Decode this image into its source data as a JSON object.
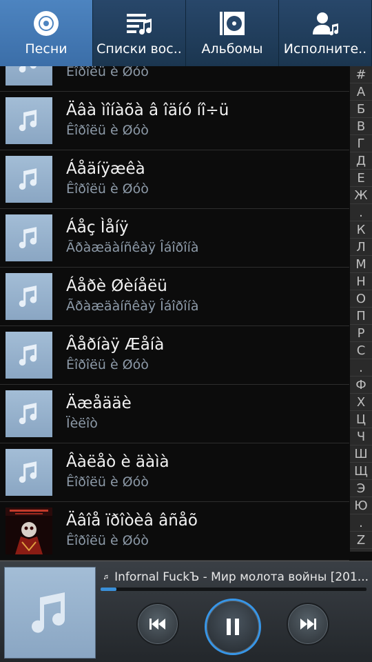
{
  "tabs": [
    {
      "label": "Песни",
      "icon": "disc-icon",
      "active": true
    },
    {
      "label": "Списки вос..",
      "icon": "playlist-icon",
      "active": false
    },
    {
      "label": "Альбомы",
      "icon": "album-icon",
      "active": false
    },
    {
      "label": "Исполните..",
      "icon": "artist-icon",
      "active": false
    }
  ],
  "songs": [
    {
      "title": "",
      "artist": "Êîðîëü è Øóò",
      "art": "note"
    },
    {
      "title": "Äâà ìîíàõà â îäíó íî÷ü",
      "artist": "Êîðîëü è Øóò",
      "art": "note"
    },
    {
      "title": "Áåäíÿæêà",
      "artist": "Êîðîëü è Øóò",
      "art": "note"
    },
    {
      "title": "Áåç Ìåíÿ",
      "artist": "Ãðàæäàíñêàÿ Îáîðîíà",
      "art": "note"
    },
    {
      "title": "Áåðè Øèíåëü",
      "artist": "Ãðàæäàíñêàÿ Îáîðîíà",
      "art": "note"
    },
    {
      "title": "Âåðíàÿ Æåíà",
      "artist": "Êîðîëü è Øóò",
      "art": "note"
    },
    {
      "title": "Äæåääè",
      "artist": "Ïèëîò",
      "art": "note"
    },
    {
      "title": "Âàëåò è äàìà",
      "artist": "Êîðîëü è Øóò",
      "art": "note"
    },
    {
      "title": "Äâîå ïðîòèâ âñåõ",
      "artist": "Êîðîëü è Øóò",
      "art": "album-cover"
    }
  ],
  "index_letters": [
    "#",
    "A",
    "Б",
    "В",
    "Г",
    "Д",
    "Е",
    "Ж",
    ".",
    "К",
    "Л",
    "М",
    "Н",
    "О",
    "П",
    "Р",
    "С",
    ".",
    "Ф",
    "Х",
    "Ц",
    "Ч",
    "Ш",
    "Щ",
    "Э",
    "Ю",
    ".",
    "Z"
  ],
  "player": {
    "now_playing": "Infornal FuckЪ - Мир молота войны [201...",
    "progress_fraction": 0.06,
    "accent_color": "#3796e8"
  }
}
